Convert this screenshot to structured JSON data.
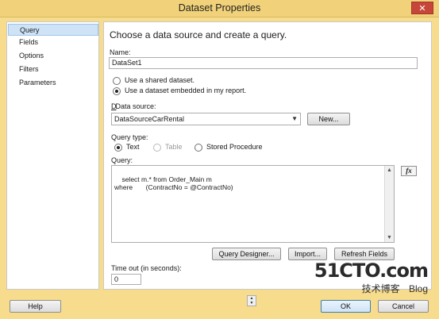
{
  "window": {
    "title": "Dataset Properties",
    "close_glyph": "✕"
  },
  "sidebar": {
    "items": [
      {
        "label": "Query",
        "selected": true
      },
      {
        "label": "Fields",
        "selected": false
      },
      {
        "label": "Options",
        "selected": false
      },
      {
        "label": "Filters",
        "selected": false
      },
      {
        "label": "Parameters",
        "selected": false
      }
    ]
  },
  "main": {
    "heading": "Choose a data source and create a query.",
    "name_label": "Name:",
    "name_value": "DataSet1",
    "dataset_options": [
      {
        "label": "Use a shared dataset.",
        "checked": false
      },
      {
        "label": "Use a dataset embedded in my report.",
        "checked": true
      }
    ],
    "data_source_label": "Data source:",
    "data_source_value": "DataSourceCarRental",
    "new_button": "New...",
    "query_type_label": "Query type:",
    "query_types": [
      {
        "label": "Text",
        "checked": true,
        "enabled": true
      },
      {
        "label": "Table",
        "checked": false,
        "enabled": false
      },
      {
        "label": "Stored Procedure",
        "checked": false,
        "enabled": true
      }
    ],
    "query_label": "Query:",
    "query_text": "select m.* from Order_Main m\nwhere       (ContractNo = @ContractNo)",
    "fx_button": "fx",
    "query_designer_button": "Query Designer...",
    "import_button": "Import...",
    "refresh_fields_button": "Refresh Fields",
    "timeout_label": "Time out (in seconds):",
    "timeout_value": "0"
  },
  "footer": {
    "help_button": "Help",
    "ok_button": "OK",
    "cancel_button": "Cancel"
  },
  "watermark": {
    "site": "51CTO.com",
    "tagline": "技术博客",
    "blog": "Blog"
  },
  "colors": {
    "title_bar": "#f1d27a",
    "frame": "#f6dc8c",
    "selection": "#cfe3f7",
    "close": "#c7463a"
  }
}
